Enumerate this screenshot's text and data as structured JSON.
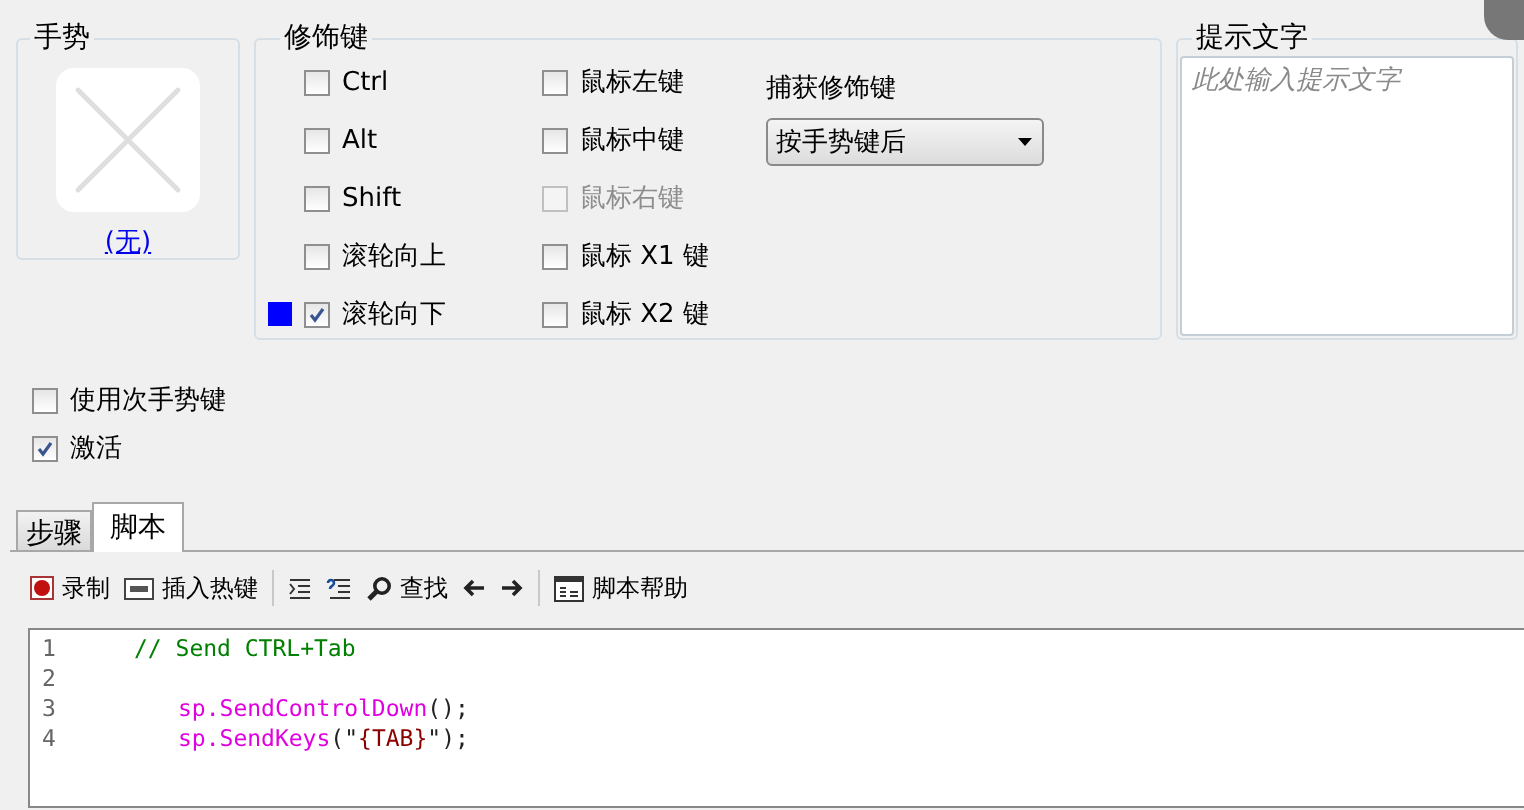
{
  "gesture": {
    "title": "手势",
    "link": "(无)"
  },
  "modifiers": {
    "title": "修饰键",
    "keys": [
      {
        "label": "Ctrl",
        "checked": false,
        "disabled": false,
        "indicator": false
      },
      {
        "label": "Alt",
        "checked": false,
        "disabled": false,
        "indicator": false
      },
      {
        "label": "Shift",
        "checked": false,
        "disabled": false,
        "indicator": false
      },
      {
        "label": "滚轮向上",
        "checked": false,
        "disabled": false,
        "indicator": false
      },
      {
        "label": "滚轮向下",
        "checked": true,
        "disabled": false,
        "indicator": true
      },
      {
        "label": "鼠标左键",
        "checked": false,
        "disabled": false,
        "indicator": false
      },
      {
        "label": "鼠标中键",
        "checked": false,
        "disabled": false,
        "indicator": false
      },
      {
        "label": "鼠标右键",
        "checked": false,
        "disabled": true,
        "indicator": false
      },
      {
        "label": "鼠标 X1 键",
        "checked": false,
        "disabled": false,
        "indicator": false
      },
      {
        "label": "鼠标 X2 键",
        "checked": false,
        "disabled": false,
        "indicator": false
      }
    ],
    "capture": {
      "label": "捕获修饰键",
      "value": "按手势键后"
    }
  },
  "hint": {
    "title": "提示文字",
    "placeholder": "此处输入提示文字"
  },
  "options": [
    {
      "label": "使用次手势键",
      "checked": false
    },
    {
      "label": "激活",
      "checked": true
    }
  ],
  "tabs": [
    {
      "label": "步骤",
      "selected": false
    },
    {
      "label": "脚本",
      "selected": true
    }
  ],
  "toolbar": [
    {
      "kind": "record",
      "label": "录制"
    },
    {
      "kind": "hotkey",
      "label": "插入热键"
    },
    {
      "kind": "separator"
    },
    {
      "kind": "indent"
    },
    {
      "kind": "outdent"
    },
    {
      "kind": "find",
      "label": "查找"
    },
    {
      "kind": "back"
    },
    {
      "kind": "forward"
    },
    {
      "kind": "separator"
    },
    {
      "kind": "help",
      "label": "脚本帮助"
    }
  ],
  "editor": {
    "lines": [
      {
        "number": "1",
        "kind": "comment",
        "tokens": [
          {
            "kind": "comment",
            "text": "// Send CTRL+Tab"
          }
        ]
      },
      {
        "number": "2",
        "kind": "blank"
      },
      {
        "number": "3",
        "kind": "code",
        "tokens": [
          {
            "kind": "code",
            "text": "sp.SendControlDown"
          },
          {
            "kind": "punct",
            "text": "();"
          }
        ]
      },
      {
        "number": "4",
        "kind": "code",
        "tokens": [
          {
            "kind": "code",
            "text": "sp.SendKeys"
          },
          {
            "kind": "punct",
            "text": "(\""
          },
          {
            "kind": "string",
            "text": "{TAB}"
          },
          {
            "kind": "punct",
            "text": "\");"
          }
        ]
      }
    ]
  }
}
